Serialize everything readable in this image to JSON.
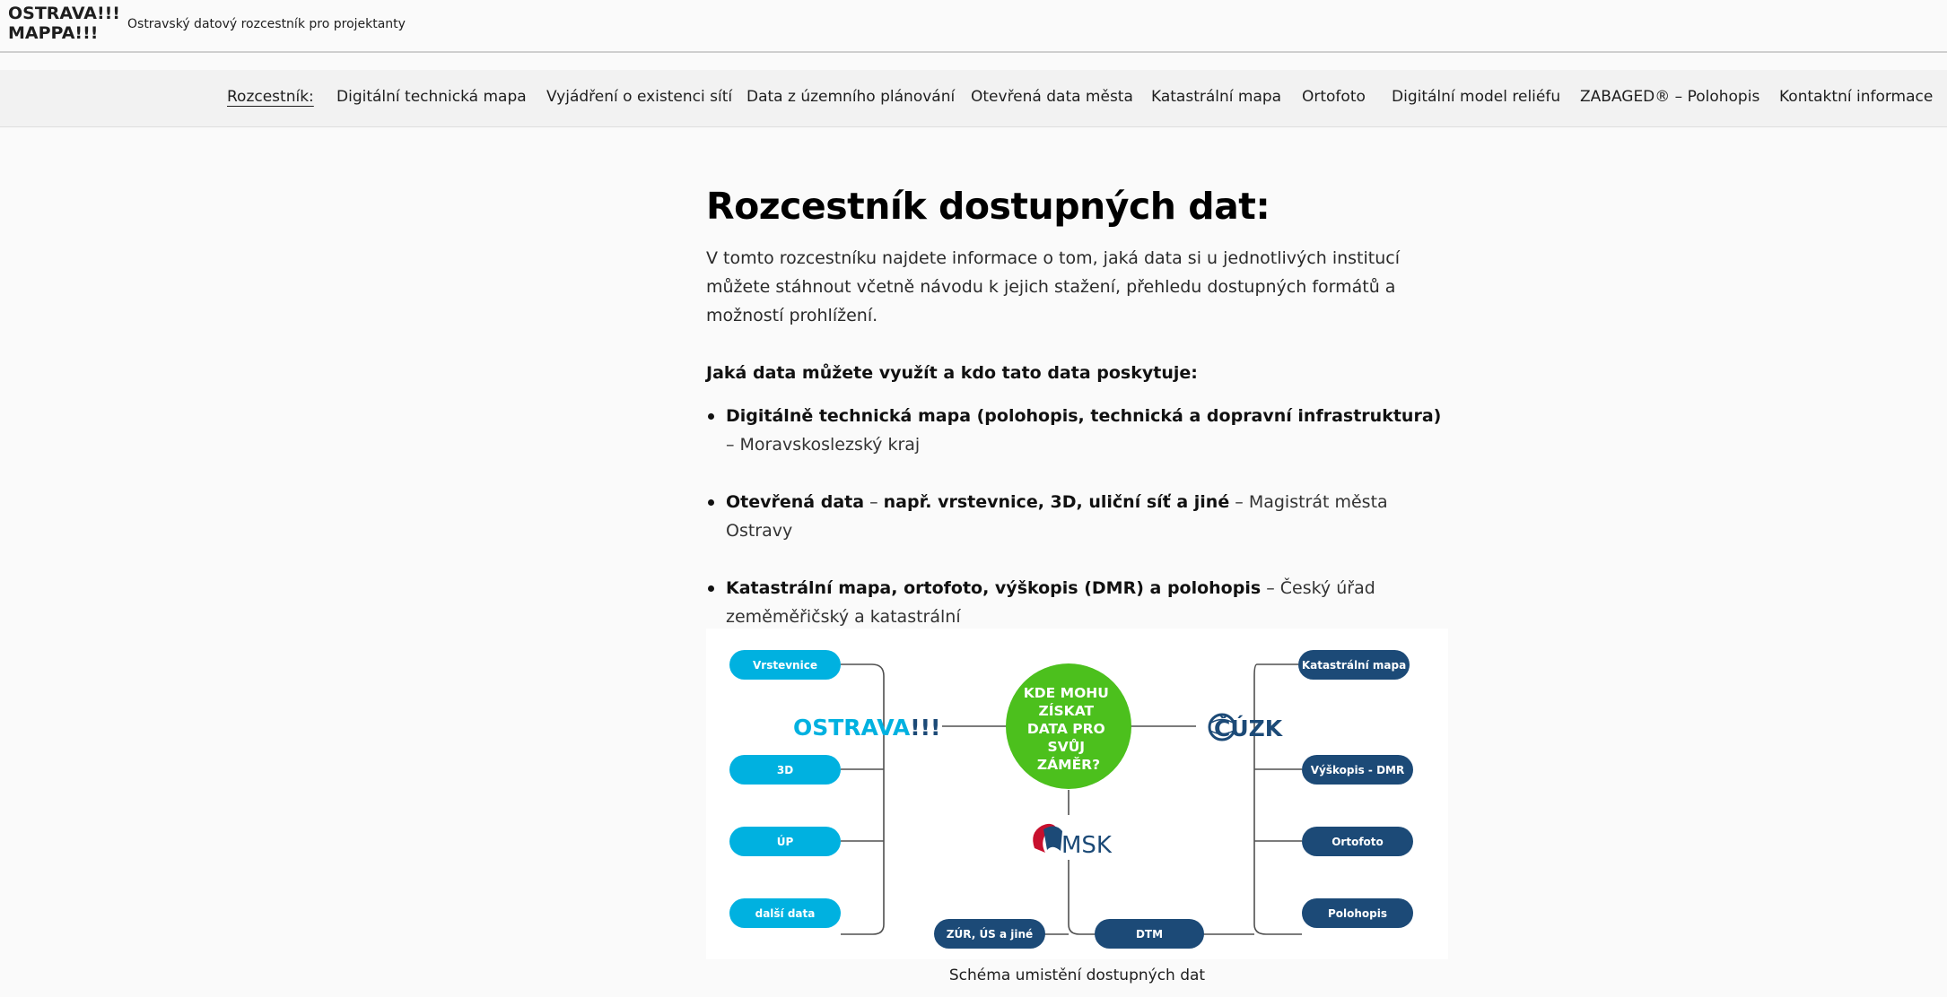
{
  "header": {
    "logo_line1": "OSTRAVA!!!",
    "logo_line2": "MAPPA!!!",
    "tagline": "Ostravský datový rozcestník pro projektanty"
  },
  "nav": {
    "items": [
      {
        "label": "Rozcestník:",
        "active": true
      },
      {
        "label": "Digitální technická mapa"
      },
      {
        "label": "Vyjádření o existenci sítí"
      },
      {
        "label": "Data z územního plánování"
      },
      {
        "label": "Otevřená data města"
      },
      {
        "label": "Katastrální mapa"
      },
      {
        "label": "Ortofoto"
      },
      {
        "label": "Digitální model reliéfu"
      },
      {
        "label": "ZABAGED® – Polohopis"
      },
      {
        "label": "Kontaktní informace"
      }
    ]
  },
  "main": {
    "title": "Rozcestník dostupných dat:",
    "intro": "V tomto rozcestníku najdete informace o tom, jaká data si u jednotlivých institucí můžete stáhnout včetně návodu k jejich stažení, přehledu dostupných formátů a možností prohlížení.",
    "subheading": "Jaká data můžete využít a kdo tato data poskytuje:",
    "sources": [
      {
        "bold": "Digitálně technická mapa (polohopis, technická a dopravní infrastruktura)",
        "rest": " – Moravskoslezský kraj"
      },
      {
        "bold": "Otevřená data",
        "mid": " – ",
        "bold2": "např. vrstevnice, 3D, uliční síť a jiné",
        "rest": " – Magistrát města Ostravy"
      },
      {
        "bold": "Katastrální mapa, ortofoto, výškopis (DMR) a polohopis",
        "rest": " – Český úřad zeměměřičský a katastrální"
      }
    ]
  },
  "diagram": {
    "center": [
      "KDE MOHU",
      "ZÍSKAT",
      "DATA PRO",
      "SVŮJ",
      "ZÁMĚR?"
    ],
    "ostrava_logo_main": "OSTRAVA",
    "ostrava_logo_bang": "!!!",
    "cuzk_logo": "ČÚZK",
    "msk_logo": "MSK",
    "left_items": [
      "Vrstevnice",
      "3D",
      "ÚP",
      "další data"
    ],
    "right_items": [
      "Katastrální mapa",
      "Výškopis - DMR",
      "Ortofoto",
      "Polohopis"
    ],
    "bottom_items": [
      "ZÚR, ÚS a jiné",
      "DTM"
    ],
    "colors": {
      "light_blue": "#00b1e0",
      "dark_blue": "#1c4a77",
      "green": "#4cc01d",
      "line": "#505050",
      "msk_red": "#c8102e"
    }
  },
  "caption": "Schéma umistění dostupných dat"
}
